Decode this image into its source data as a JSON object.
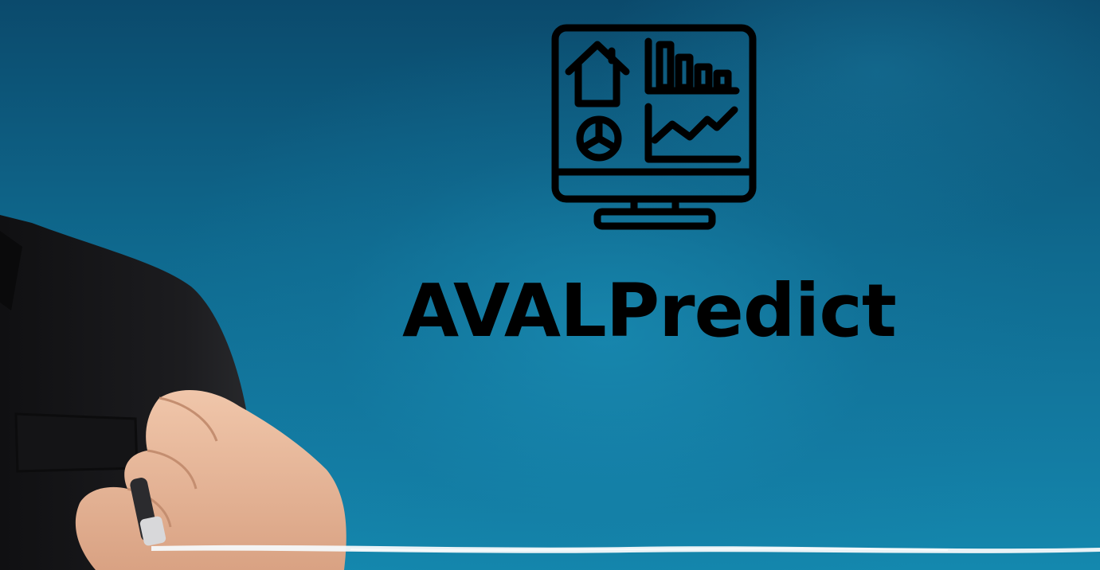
{
  "brand": {
    "title": "AVALPredict"
  },
  "icons": {
    "main": "monitor-dashboard-icon",
    "parts": [
      "house-icon",
      "bar-chart-icon",
      "pie-chart-icon",
      "line-chart-icon"
    ]
  },
  "colors": {
    "background_dark": "#0b4a6c",
    "background_light": "#1488ae",
    "icon_and_text": "#000000",
    "suit": "#1a1a1c",
    "skin": "#e8b89a",
    "marker_stroke": "#f4f8fa"
  }
}
